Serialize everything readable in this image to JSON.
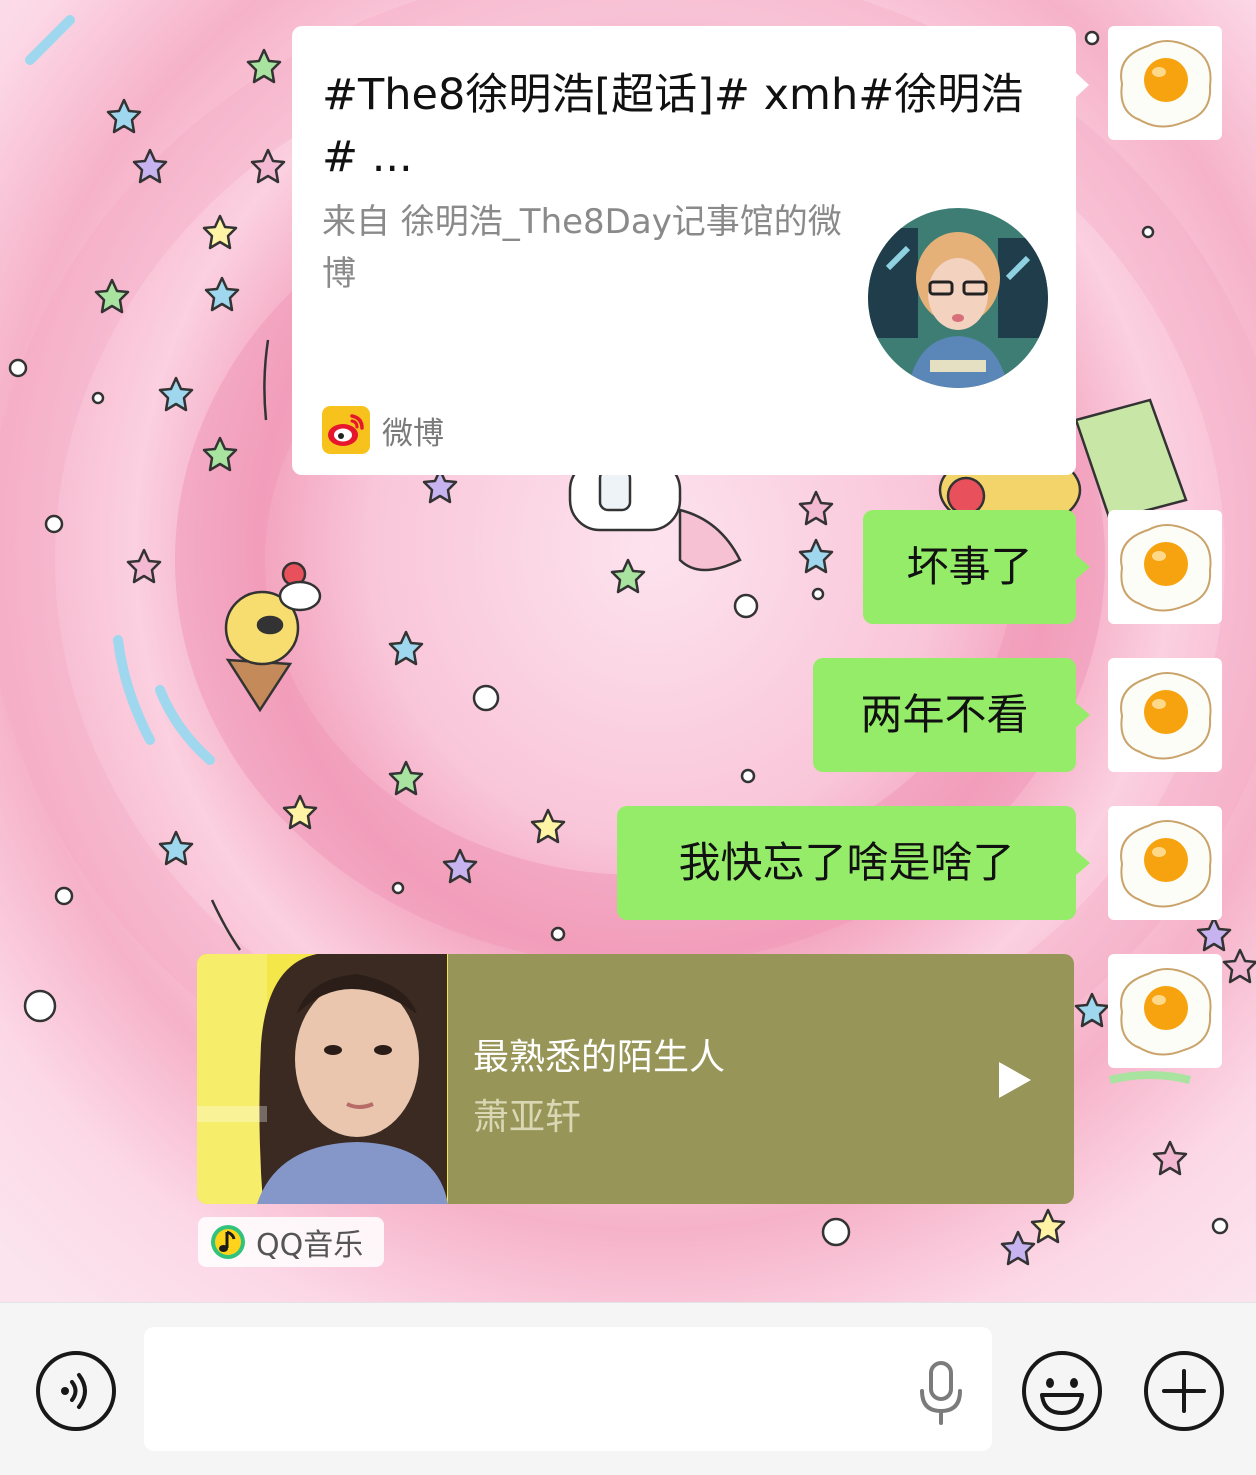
{
  "weibo_card": {
    "title": "#The8徐明浩[超话]# xmh#徐明浩# ...",
    "description": "来自 徐明浩_The8Day记事馆的微博",
    "source_label": "微博"
  },
  "messages": [
    {
      "text": "坏事了"
    },
    {
      "text": "两年不看"
    },
    {
      "text": "我快忘了啥是啥了"
    }
  ],
  "music_card": {
    "song_title": "最熟悉的陌生人",
    "artist": "萧亚轩",
    "source_label": "QQ音乐"
  },
  "input_bar": {
    "message_value": "",
    "icons": [
      "voice-mode-icon",
      "microphone-icon",
      "emoji-icon",
      "more-plus-icon"
    ]
  },
  "colors": {
    "bubble_green": "#95ec69",
    "music_card_bg": "#979557",
    "wallpaper_pink": "#fbd3e2"
  }
}
